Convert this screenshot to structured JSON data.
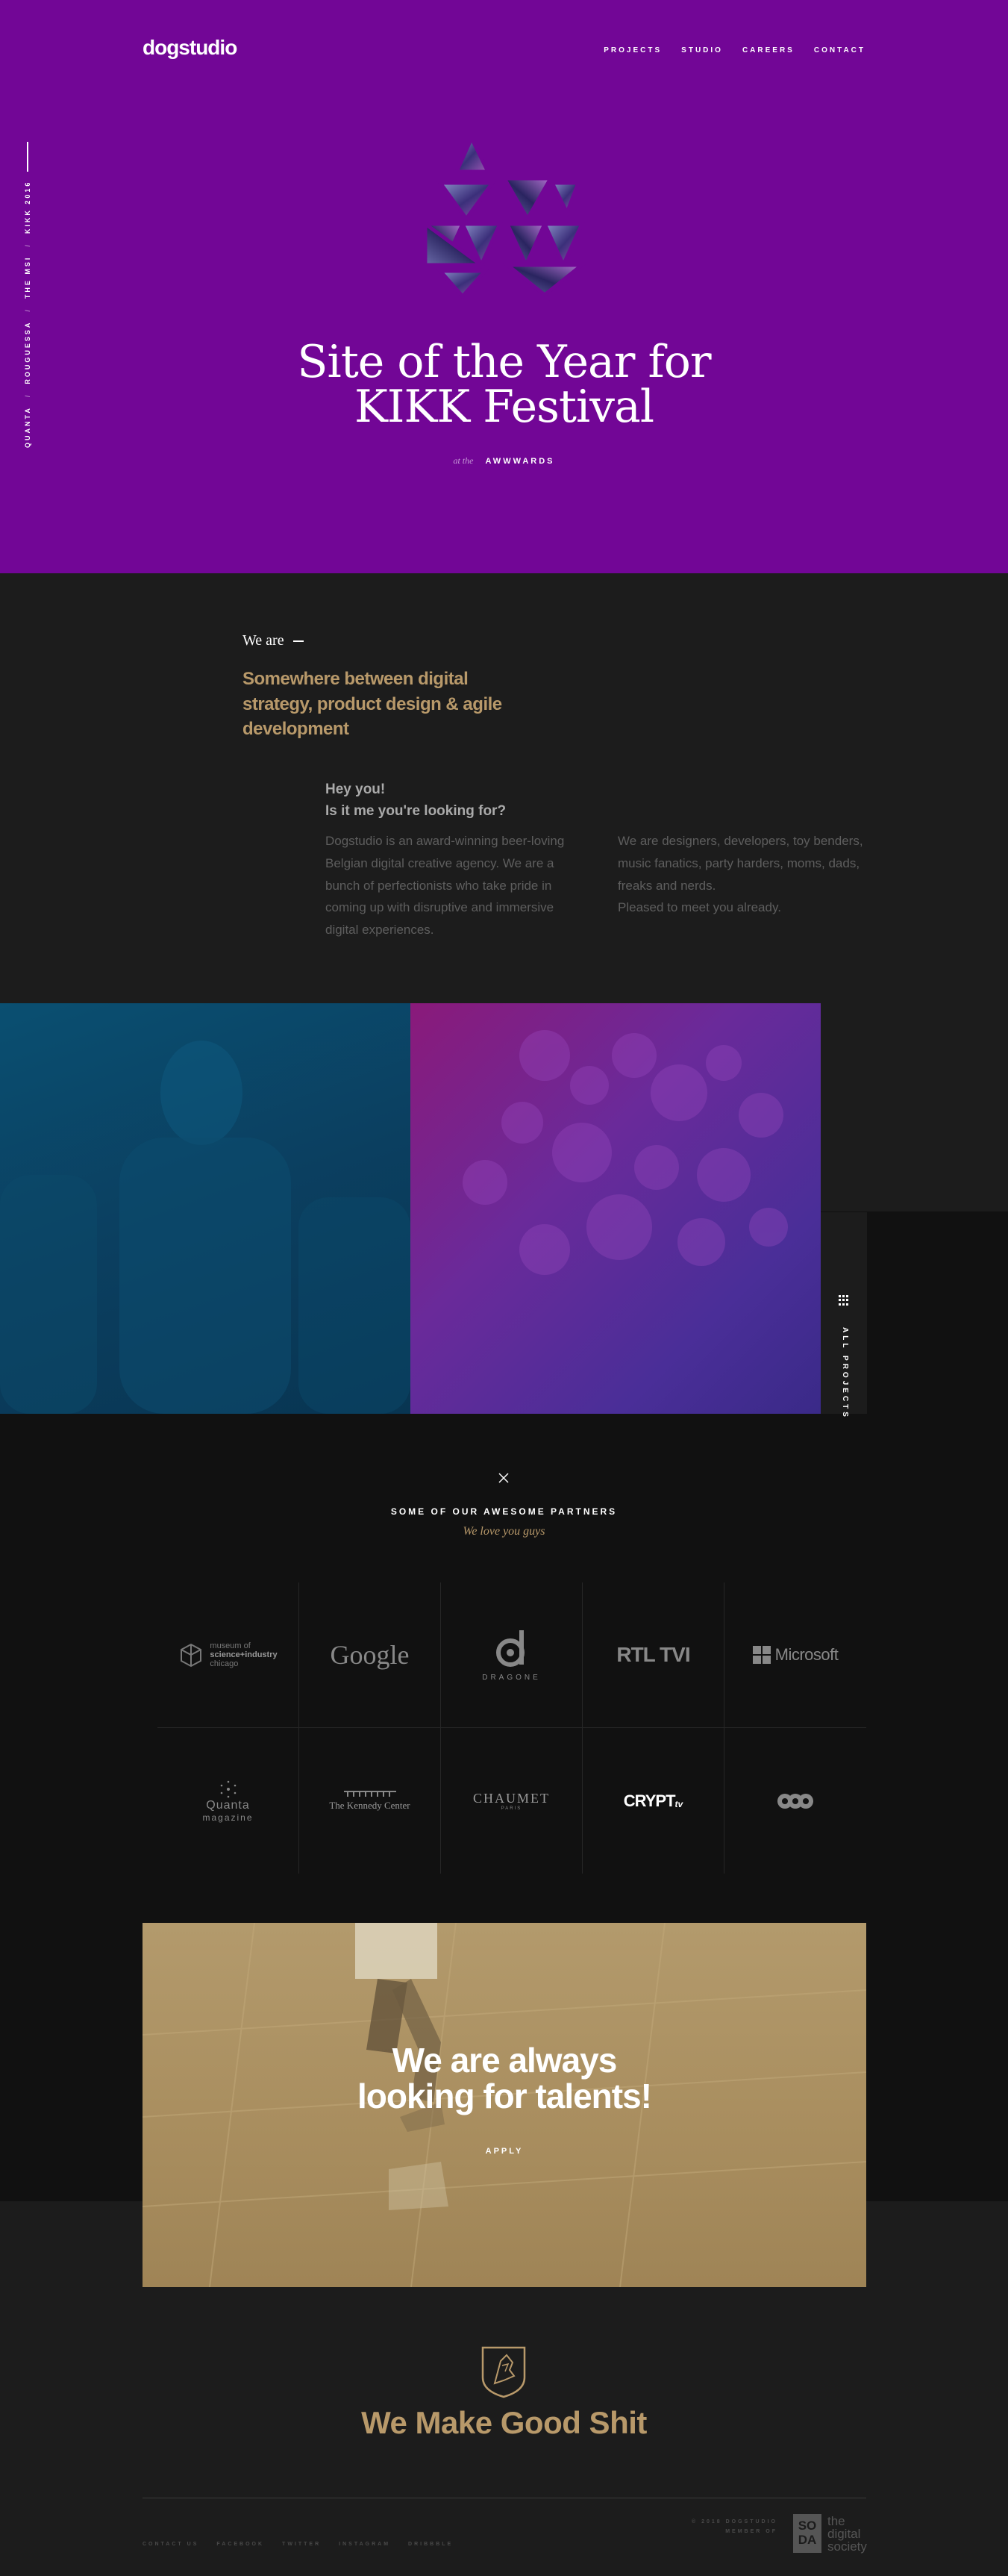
{
  "header": {
    "logo": "dogstudio",
    "nav": [
      "PROJECTS",
      "STUDIO",
      "CAREERS",
      "CONTACT"
    ]
  },
  "hero": {
    "side_projects": [
      "QUANTA",
      "ROUGUESSA",
      "THE MSI",
      "KIKK 2016"
    ],
    "side_separator": "/",
    "title_line1": "Site of the Year for",
    "title_line2": "KIKK Festival",
    "at_the": "at the",
    "award": "AWWWARDS"
  },
  "about": {
    "heading": "We are",
    "tagline": "Somewhere between digital strategy, product design & agile development",
    "hey_line1": "Hey you!",
    "hey_line2": "Is it me you're looking for?",
    "col1": "Dogstudio is an award-winning beer-loving Belgian digital creative agency. We are a bunch of perfectionists who take pride in coming up with disruptive and immersive digital experiences.",
    "col2_p1": "We are designers, developers, toy benders, music fanatics, party harders, moms, dads, freaks and nerds.",
    "col2_p2": "Pleased to meet you already."
  },
  "projects": {
    "all_projects": "ALL PROJECTS"
  },
  "partners": {
    "title": "SOME OF OUR AWESOME PARTNERS",
    "subtitle": "We love you guys",
    "logos": [
      {
        "name": "museum of science+industry chicago",
        "line1": "museum of",
        "line2": "science+industry",
        "line3": "chicago"
      },
      {
        "name": "Google",
        "text": "Google"
      },
      {
        "name": "Dragone",
        "text": "DRAGONE"
      },
      {
        "name": "RTL TVI",
        "text": "RTL TVI"
      },
      {
        "name": "Microsoft",
        "text": "Microsoft"
      },
      {
        "name": "Quanta magazine",
        "line1": "Quanta",
        "line2": "magazine"
      },
      {
        "name": "The Kennedy Center",
        "text": "The Kennedy Center"
      },
      {
        "name": "Chaumet",
        "text": "CHAUMET",
        "sub": "PARIS"
      },
      {
        "name": "Crypt TV",
        "text": "CRYPT",
        "tv": "tv"
      },
      {
        "name": "VOO",
        "text": "VOO"
      }
    ]
  },
  "talent": {
    "title_line1": "We are always",
    "title_line2": "looking for talents!",
    "apply": "APPLY"
  },
  "footer": {
    "motto": "We Make Good Shit",
    "links": [
      "CONTACT US",
      "FACEBOOK",
      "TWITTER",
      "INSTAGRAM",
      "DRIBBBLE"
    ],
    "right_line1": "© 2018 DOGSTUDIO",
    "right_line2": "MEMBER OF",
    "soda": [
      "SO",
      "DA"
    ],
    "soda_text": [
      "the",
      "digital",
      "society"
    ]
  },
  "colors": {
    "hero_bg": "#720696",
    "gold": "#b8996a",
    "dark": "#1c1c1c",
    "darker": "#111111"
  }
}
